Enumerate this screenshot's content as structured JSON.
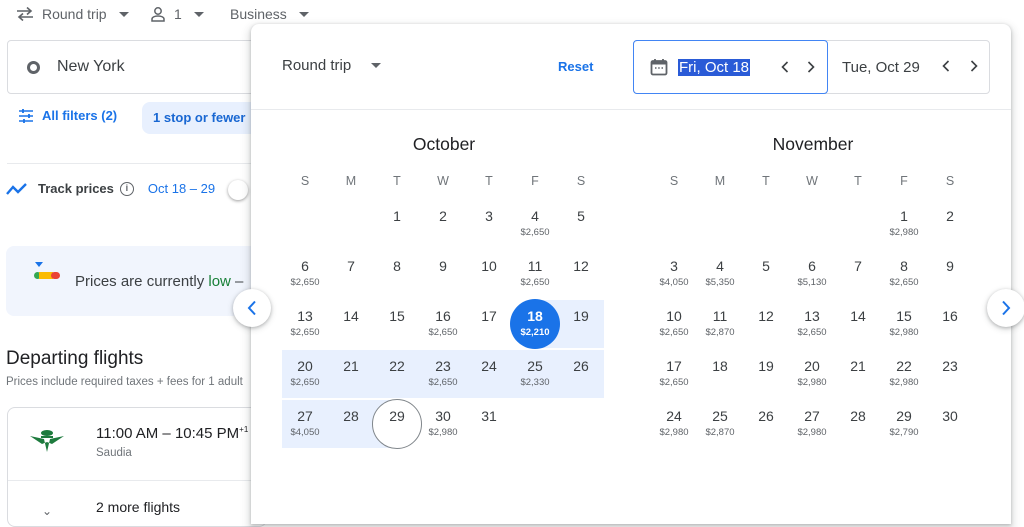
{
  "topbar": {
    "trip_type": "Round trip",
    "passengers": "1",
    "cabin_class": "Business"
  },
  "search": {
    "origin": "New York"
  },
  "filters": {
    "all_filters_label": "All filters (2)",
    "stops_chip": "1 stop or fewer"
  },
  "track_prices": {
    "label": "Track prices",
    "dates": "Oct 18 – 29"
  },
  "price_banner": {
    "prefix": "Prices are currently ",
    "level": "low",
    "suffix": " –"
  },
  "departing": {
    "title": "Departing flights",
    "subtitle": "Prices include required taxes + fees for 1 adult",
    "flights": [
      {
        "times": "11:00 AM – 10:45 PM",
        "day_offset": "+1",
        "airline": "Saudia"
      }
    ],
    "more_flights": "2 more flights"
  },
  "date_picker": {
    "trip_type": "Round trip",
    "reset_label": "Reset",
    "departure_date": "Fri, Oct 18",
    "return_date": "Tue, Oct 29",
    "weekday_headers": [
      "S",
      "M",
      "T",
      "W",
      "T",
      "F",
      "S"
    ],
    "selected_departure_day": 18,
    "selected_return_day": 29,
    "months": [
      {
        "name": "October",
        "first_weekday": 2,
        "num_days": 31,
        "prices": {
          "4": "$2,650",
          "6": "$2,650",
          "11": "$2,650",
          "13": "$2,650",
          "16": "$2,650",
          "18": "$2,210",
          "20": "$2,650",
          "23": "$2,650",
          "25": "$2,330",
          "27": "$4,050",
          "30": "$2,980"
        }
      },
      {
        "name": "November",
        "first_weekday": 5,
        "num_days": 30,
        "prices": {
          "1": "$2,980",
          "3": "$4,050",
          "4": "$5,350",
          "6": "$5,130",
          "8": "$2,650",
          "10": "$2,650",
          "11": "$2,870",
          "13": "$2,650",
          "15": "$2,980",
          "17": "$2,650",
          "20": "$2,980",
          "22": "$2,980",
          "24": "$2,980",
          "25": "$2,870",
          "27": "$2,980",
          "29": "$2,790"
        }
      }
    ]
  },
  "colors": {
    "accent": "#1a73e8",
    "range_highlight": "#e8f0fe",
    "price_low": "#188038"
  }
}
